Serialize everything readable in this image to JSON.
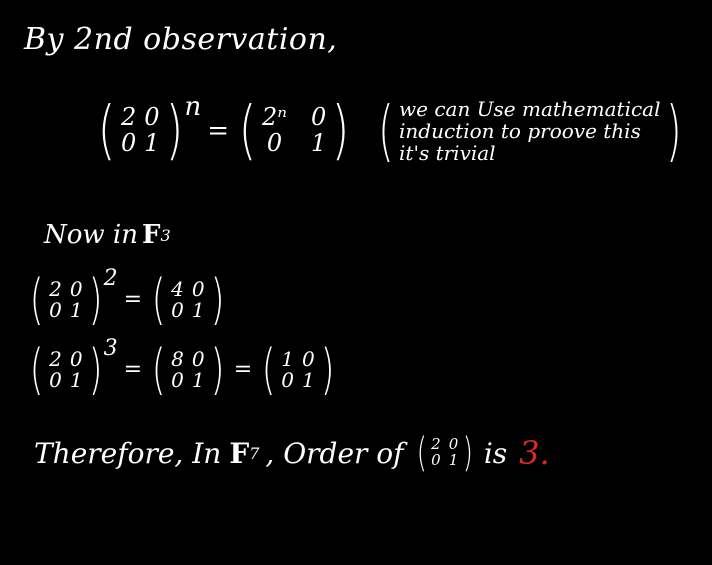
{
  "line1": "By 2nd observation,",
  "eq1": {
    "lhs": [
      "2",
      "0",
      "0",
      "1"
    ],
    "lhs_exp": "n",
    "rhs": [
      "2ⁿ",
      "0",
      "0",
      "1"
    ],
    "note": [
      "we can Use mathematical",
      "induction to proove this",
      "it's trivial"
    ]
  },
  "line3": {
    "text": "Now in",
    "field": "F",
    "sub": "3"
  },
  "eq2": {
    "lhs": [
      "2",
      "0",
      "0",
      "1"
    ],
    "exp": "2",
    "rhs": [
      "4",
      "0",
      "0",
      "1"
    ]
  },
  "eq3": {
    "lhs": [
      "2",
      "0",
      "0",
      "1"
    ],
    "exp": "3",
    "mid": [
      "8",
      "0",
      "0",
      "1"
    ],
    "rhs": [
      "1",
      "0",
      "0",
      "1"
    ]
  },
  "conclusion": {
    "prefix": "Therefore, In",
    "field": "F",
    "sub": "7",
    "middle": ", Order of",
    "matrix": [
      "2",
      "0",
      "0",
      "1"
    ],
    "is": "is",
    "answer": "3.",
    "answer_color": "#d92b1f"
  }
}
